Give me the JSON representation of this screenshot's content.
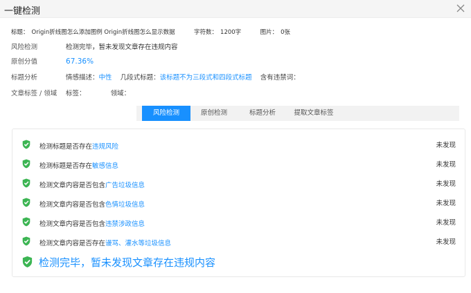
{
  "window": {
    "title": "一键检测"
  },
  "meta": {
    "title_label": "标题：",
    "title_value": "Origin折线图怎么添加图例 Origin折线图怎么显示数据",
    "chars_label": "字符数：",
    "chars_value": "1200字",
    "images_label": "图片：",
    "images_value": "0张"
  },
  "risk": {
    "label": "风险检测",
    "value": "检测完毕，暂未发现文章存在违规内容"
  },
  "originality": {
    "label": "原创分值",
    "value": "67.36%"
  },
  "title_analysis": {
    "label": "标题分析",
    "sentiment_label": "情感描述：",
    "sentiment_value": "中性",
    "structure_label": "几段式标题：",
    "structure_value": "该标题不为三段式和四段式标题",
    "banned_label": "含有违禁词："
  },
  "tags": {
    "label": "文章标签 / 领域",
    "tag_label": "标签：",
    "field_label": "领域："
  },
  "tabs": [
    {
      "label": "风险检测",
      "active": true
    },
    {
      "label": "原创检测",
      "active": false
    },
    {
      "label": "标题分析",
      "active": false
    },
    {
      "label": "提取文章标签",
      "active": false
    }
  ],
  "checks": [
    {
      "prefix": "检测标题是否存在",
      "highlight": "违规风险",
      "status": "未发现"
    },
    {
      "prefix": "检测标题是否存在",
      "highlight": "敏感信息",
      "status": "未发现"
    },
    {
      "prefix": "检测文章内容是否包含",
      "highlight": "广告垃圾信息",
      "status": "未发现"
    },
    {
      "prefix": "检测文章内容是否包含",
      "highlight": "色情垃圾信息",
      "status": "未发现"
    },
    {
      "prefix": "检测文章内容是否包含",
      "highlight": "违禁涉政信息",
      "status": "未发现"
    },
    {
      "prefix": "检测文章内容是否存在",
      "highlight": "谩骂、灌水等垃圾信息",
      "status": "未发现"
    }
  ],
  "summary": {
    "text": "检测完毕，暂未发现文章存在违规内容"
  },
  "colors": {
    "accent": "#1890ff",
    "success": "#3cb553"
  },
  "icons": {
    "close": "close-icon",
    "check": "shield-check-icon"
  }
}
